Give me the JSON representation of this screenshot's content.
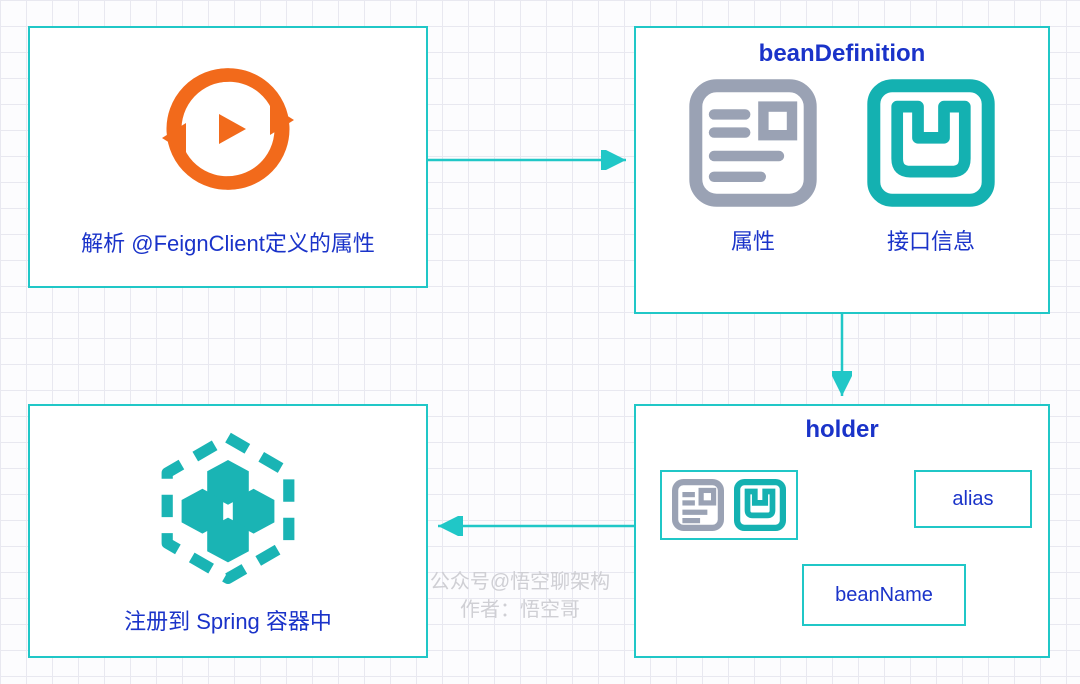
{
  "box1": {
    "caption": "解析 @FeignClient定义的属性"
  },
  "box2": {
    "title": "beanDefinition",
    "attr_label": "属性",
    "iface_label": "接口信息"
  },
  "box3": {
    "caption": "注册到 Spring 容器中"
  },
  "box4": {
    "title": "holder",
    "alias": "alias",
    "beanName": "beanName"
  },
  "watermark": {
    "line1": "公众号@悟空聊架构",
    "line2": "作者：悟空哥"
  }
}
